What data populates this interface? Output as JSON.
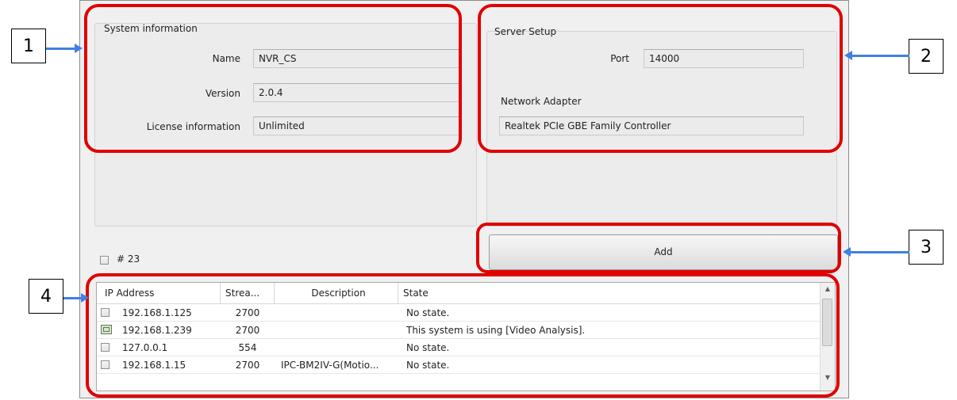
{
  "system_info": {
    "title": "System information",
    "name_label": "Name",
    "name_value": "NVR_CS",
    "version_label": "Version",
    "version_value": "2.0.4",
    "license_label": "License information",
    "license_value": "Unlimited"
  },
  "server_setup": {
    "title": "Server Setup",
    "port_label": "Port",
    "port_value": "14000",
    "adapter_label": "Network Adapter",
    "adapter_value": "Realtek PCIe GBE Family Controller"
  },
  "add_button": {
    "label": "Add"
  },
  "select_all": {
    "label": "# 23"
  },
  "table": {
    "columns": [
      "IP Address",
      "Strea...",
      "Description",
      "State"
    ],
    "rows": [
      {
        "ip": "192.168.1.125",
        "stream": "2700",
        "description": "",
        "state": "No state.",
        "icon": "checkbox"
      },
      {
        "ip": "192.168.1.239",
        "stream": "2700",
        "description": "",
        "state": "This system is using [Video Analysis].",
        "icon": "video-analysis-icon"
      },
      {
        "ip": "127.0.0.1",
        "stream": "554",
        "description": "",
        "state": "No state.",
        "icon": "checkbox"
      },
      {
        "ip": "192.168.1.15",
        "stream": "2700",
        "description": "IPC-BM2IV-G(Motio...",
        "state": "No state.",
        "icon": "checkbox"
      }
    ]
  },
  "callouts": [
    "1",
    "2",
    "3",
    "4"
  ],
  "colors": {
    "annotation": "#e00000",
    "arrow": "#3f7fe6"
  }
}
